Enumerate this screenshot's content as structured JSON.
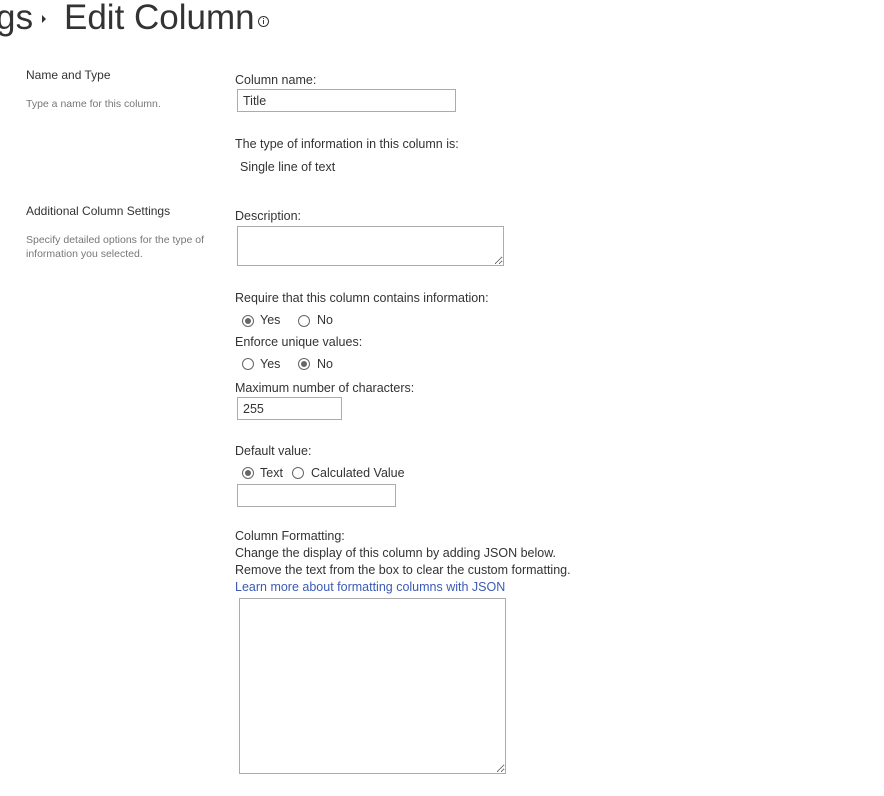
{
  "header": {
    "breadcrumb_prev": "gs",
    "title": "Edit Column"
  },
  "sections": {
    "name_type": {
      "title": "Name and Type",
      "description": "Type a name for this column."
    },
    "additional": {
      "title": "Additional Column Settings",
      "description": "Specify detailed options for the type of information you selected."
    }
  },
  "fields": {
    "column_name": {
      "label": "Column name:",
      "value": "Title"
    },
    "type_info": {
      "label": "The type of information in this column is:",
      "value": "Single line of text"
    },
    "description": {
      "label": "Description:",
      "value": ""
    },
    "require": {
      "label": "Require that this column contains information:",
      "options": [
        "Yes",
        "No"
      ],
      "selected": "Yes"
    },
    "unique": {
      "label": "Enforce unique values:",
      "options": [
        "Yes",
        "No"
      ],
      "selected": "No"
    },
    "max_chars": {
      "label": "Maximum number of characters:",
      "value": "255"
    },
    "default_value": {
      "label": "Default value:",
      "options": [
        "Text",
        "Calculated Value"
      ],
      "selected": "Text",
      "value": ""
    },
    "formatting": {
      "label": "Column Formatting:",
      "line1": "Change the display of this column by adding JSON below.",
      "line2": "Remove the text from the box to clear the custom formatting.",
      "link": "Learn more about formatting columns with JSON",
      "value": ""
    }
  },
  "colors": {
    "link": "#3b5bb5",
    "text": "#333333",
    "muted": "#777777"
  }
}
